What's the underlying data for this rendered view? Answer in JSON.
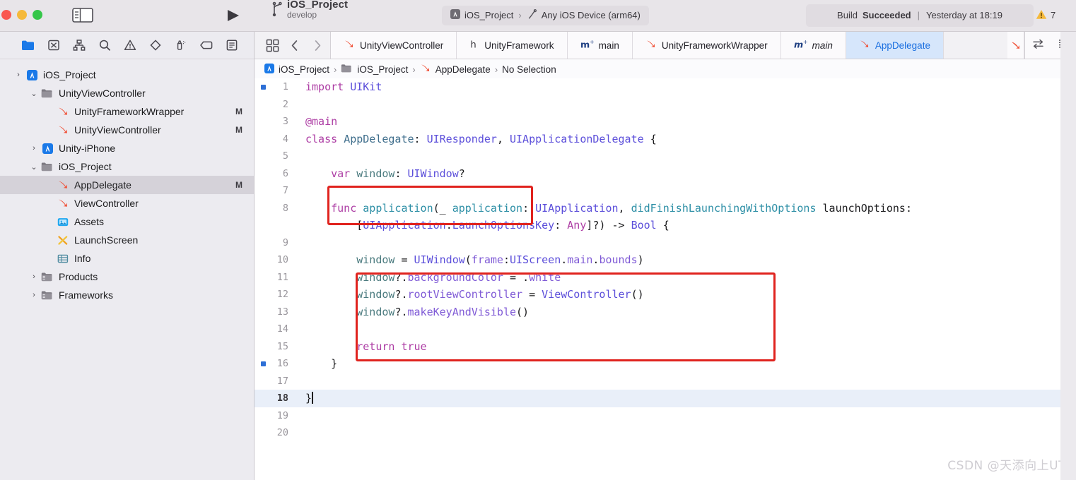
{
  "window": {
    "traffic_lights": [
      "close",
      "minimize",
      "zoom"
    ],
    "sidebar_toggle_icon": "sidebar-toggle-icon",
    "run_icon": "run-play-icon"
  },
  "toolbar": {
    "branch": {
      "project": "iOS_Project",
      "branch_name": "develop",
      "icon": "source-control-branch-icon"
    },
    "scheme": {
      "target": "iOS_Project",
      "target_icon": "app-icon",
      "separator": "›",
      "destination": "Any iOS Device (arm64)",
      "destination_icon": "wrench-icon"
    },
    "status": {
      "prefix": "Build",
      "result": "Succeeded",
      "divider": "|",
      "timestamp": "Yesterday at 18:19"
    },
    "warnings": {
      "icon": "warning-triangle-icon",
      "count": "7"
    }
  },
  "navigator": {
    "toolbar_icons": [
      "project-navigator-icon",
      "source-control-navigator-icon",
      "symbol-navigator-icon",
      "find-navigator-icon",
      "issue-navigator-icon",
      "test-navigator-icon",
      "debug-navigator-icon",
      "breakpoint-navigator-icon",
      "report-navigator-icon"
    ],
    "items": [
      {
        "label": "iOS_Project",
        "icon": "xcode-project-icon",
        "indent": 0,
        "twisty": "›",
        "badge": "",
        "selected": false
      },
      {
        "label": "UnityViewController",
        "icon": "folder-icon",
        "indent": 1,
        "twisty": "⌄",
        "badge": "",
        "selected": false
      },
      {
        "label": "UnityFrameworkWrapper",
        "icon": "swift-file-icon",
        "indent": 2,
        "twisty": "",
        "badge": "M",
        "selected": false
      },
      {
        "label": "UnityViewController",
        "icon": "swift-file-icon",
        "indent": 2,
        "twisty": "",
        "badge": "M",
        "selected": false
      },
      {
        "label": "Unity-iPhone",
        "icon": "xcode-project-icon",
        "indent": 1,
        "twisty": "›",
        "badge": "",
        "selected": false
      },
      {
        "label": "iOS_Project",
        "icon": "folder-icon",
        "indent": 1,
        "twisty": "⌄",
        "badge": "",
        "selected": false
      },
      {
        "label": "AppDelegate",
        "icon": "swift-file-icon",
        "indent": 2,
        "twisty": "",
        "badge": "M",
        "selected": true
      },
      {
        "label": "ViewController",
        "icon": "swift-file-icon",
        "indent": 2,
        "twisty": "",
        "badge": "",
        "selected": false
      },
      {
        "label": "Assets",
        "icon": "assets-catalog-icon",
        "indent": 2,
        "twisty": "",
        "badge": "",
        "selected": false
      },
      {
        "label": "LaunchScreen",
        "icon": "storyboard-icon",
        "indent": 2,
        "twisty": "",
        "badge": "",
        "selected": false
      },
      {
        "label": "Info",
        "icon": "plist-icon",
        "indent": 2,
        "twisty": "",
        "badge": "",
        "selected": false
      },
      {
        "label": "Products",
        "icon": "group-folder-icon",
        "indent": 1,
        "twisty": "›",
        "badge": "",
        "selected": false
      },
      {
        "label": "Frameworks",
        "icon": "group-folder-icon",
        "indent": 1,
        "twisty": "›",
        "badge": "",
        "selected": false
      }
    ]
  },
  "editor": {
    "tab_nav": {
      "grid_icon": "tab-overview-icon",
      "back_icon": "chevron-left-icon",
      "forward_icon": "chevron-right-icon"
    },
    "tabs": [
      {
        "label": "UnityViewController",
        "icon": "swift-file-icon",
        "active": false,
        "italic": false
      },
      {
        "label": "UnityFramework",
        "icon": "header-file-icon",
        "active": false,
        "italic": false
      },
      {
        "label": "main",
        "icon": "objc-file-icon",
        "active": false,
        "italic": false
      },
      {
        "label": "UnityFrameworkWrapper",
        "icon": "swift-file-icon",
        "active": false,
        "italic": false
      },
      {
        "label": "main",
        "icon": "objc-file-icon",
        "active": false,
        "italic": true
      },
      {
        "label": "AppDelegate",
        "icon": "swift-file-icon",
        "active": true,
        "italic": false
      }
    ],
    "tab_right_icons": [
      "related-items-icon",
      "editor-options-icon"
    ],
    "breadcrumb": [
      {
        "label": "iOS_Project",
        "icon": "xcode-project-icon"
      },
      {
        "label": "iOS_Project",
        "icon": "folder-icon"
      },
      {
        "label": "AppDelegate",
        "icon": "swift-file-icon"
      },
      {
        "label": "No Selection",
        "icon": ""
      }
    ],
    "breadcrumb_separator": "›",
    "current_line": 18,
    "gutter_change_marker_lines": [
      1,
      16
    ],
    "lines": [
      {
        "n": "1",
        "text": "import UIKit"
      },
      {
        "n": "2",
        "text": ""
      },
      {
        "n": "3",
        "text": "@main"
      },
      {
        "n": "4",
        "text": "class AppDelegate: UIResponder, UIApplicationDelegate {"
      },
      {
        "n": "5",
        "text": ""
      },
      {
        "n": "6",
        "text": "    var window: UIWindow?"
      },
      {
        "n": "7",
        "text": ""
      },
      {
        "n": "8",
        "text": "    func application(_ application: UIApplication, didFinishLaunchingWithOptions launchOptions:"
      },
      {
        "n": "",
        "text": "        [UIApplication.LaunchOptionsKey: Any]?) -> Bool {"
      },
      {
        "n": "9",
        "text": ""
      },
      {
        "n": "10",
        "text": "        window = UIWindow(frame:UIScreen.main.bounds)"
      },
      {
        "n": "11",
        "text": "        window?.backgroundColor = .white"
      },
      {
        "n": "12",
        "text": "        window?.rootViewController = ViewController()"
      },
      {
        "n": "13",
        "text": "        window?.makeKeyAndVisible()"
      },
      {
        "n": "14",
        "text": ""
      },
      {
        "n": "15",
        "text": "        return true"
      },
      {
        "n": "16",
        "text": "    }"
      },
      {
        "n": "17",
        "text": ""
      },
      {
        "n": "18",
        "text": "}"
      },
      {
        "n": "19",
        "text": ""
      },
      {
        "n": "20",
        "text": ""
      }
    ],
    "annotations": [
      {
        "name": "window-property-highlight",
        "color": "#e0231e"
      },
      {
        "name": "window-setup-highlight",
        "color": "#e0231e"
      }
    ]
  },
  "watermark": {
    "text": "CSDN @天添向上UT"
  },
  "colors": {
    "accent_blue": "#1a6fe0",
    "selected_tab_bg": "#d6e6fb",
    "annotation_red": "#e0231e",
    "warning_yellow": "#f5b93b",
    "swift_orange": "#f05138"
  }
}
